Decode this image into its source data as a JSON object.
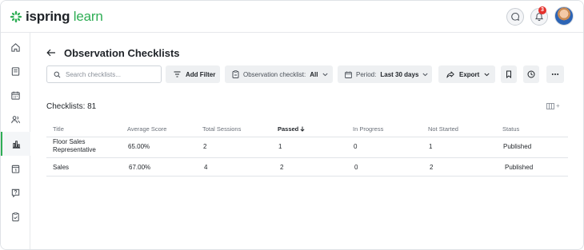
{
  "header": {
    "logo": {
      "brand": "ispring",
      "product": " learn"
    },
    "chat_icon": "chat-icon",
    "notifications": {
      "icon": "bell-icon",
      "count": "3"
    },
    "avatar": "user-avatar"
  },
  "sidebar": {
    "items": [
      {
        "name": "home",
        "icon": "home-icon",
        "active": false
      },
      {
        "name": "courses",
        "icon": "book-icon",
        "active": false
      },
      {
        "name": "calendar",
        "icon": "calendar-icon",
        "active": false
      },
      {
        "name": "users",
        "icon": "users-icon",
        "active": false
      },
      {
        "name": "reports",
        "icon": "bar-chart-icon",
        "active": true
      },
      {
        "name": "events",
        "icon": "calendar-day-icon",
        "active": false
      },
      {
        "name": "help",
        "icon": "question-icon",
        "active": false
      },
      {
        "name": "checklists",
        "icon": "clipboard-icon",
        "active": false
      }
    ]
  },
  "page": {
    "back_icon": "arrow-left-icon",
    "title": "Observation Checklists"
  },
  "toolbar": {
    "search_placeholder": "Search checklists...",
    "add_filter": "Add Filter",
    "checklist_filter_label": "Observation checklist:",
    "checklist_filter_value": "All",
    "period_label": "Period:",
    "period_value": "Last 30 days",
    "export": "Export"
  },
  "summary": {
    "count_label": "Checklists: 81"
  },
  "table": {
    "columns": [
      "Title",
      "Average Score",
      "Total Sessions",
      "Passed",
      "In Progress",
      "Not Started",
      "Status"
    ],
    "sorted_column": "Passed",
    "sort_direction": "desc",
    "rows": [
      {
        "title": "Floor Sales Representative",
        "average_score": "65.00%",
        "total_sessions": "2",
        "passed": "1",
        "in_progress": "0",
        "not_started": "1",
        "status": "Published"
      },
      {
        "title": "Sales",
        "average_score": "67.00%",
        "total_sessions": "4",
        "passed": "2",
        "in_progress": "0",
        "not_started": "2",
        "status": "Published"
      }
    ]
  },
  "colors": {
    "brand_green": "#2fae55",
    "notification_red": "#e5322d",
    "button_bg": "#eef0f2"
  }
}
